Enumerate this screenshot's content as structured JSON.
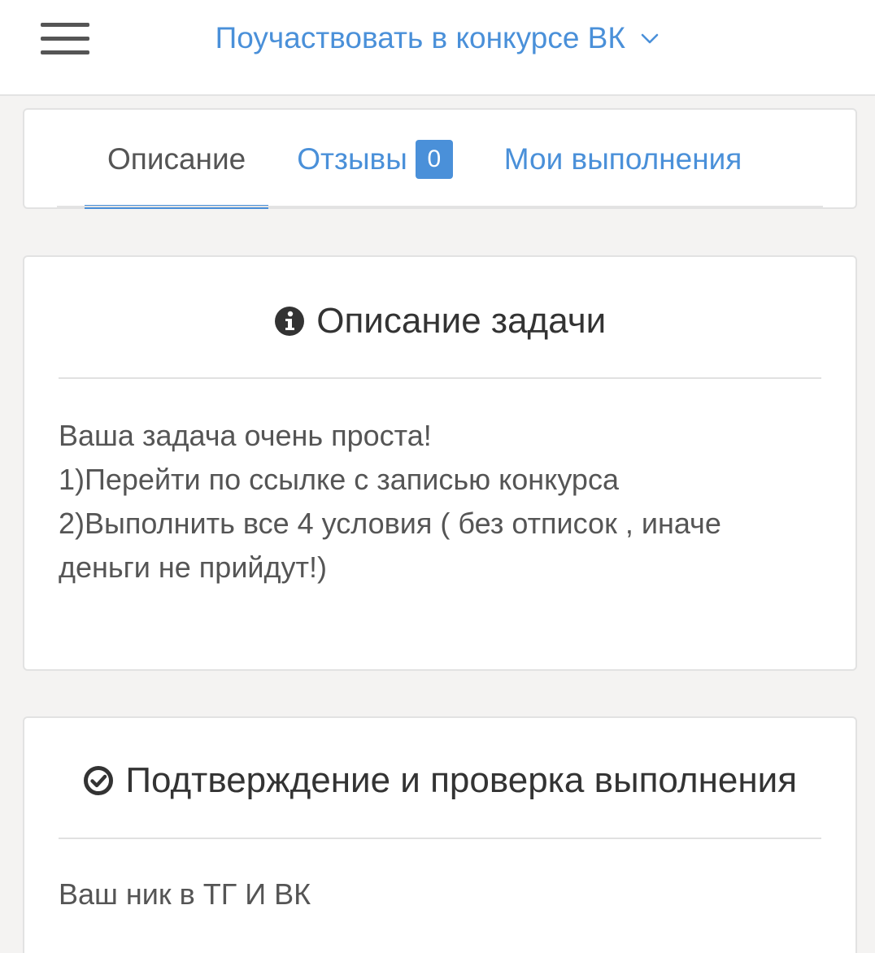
{
  "header": {
    "title": "Поучаствовать в конкурсе ВК",
    "menu_icon": "hamburger-icon",
    "dropdown_icon": "chevron-down-icon",
    "accent_color": "#4a90d9"
  },
  "tabs": [
    {
      "label": "Описание",
      "active": true
    },
    {
      "label": "Отзывы",
      "badge": "0",
      "active": false
    },
    {
      "label": "Мои выполнения",
      "active": false
    }
  ],
  "description_card": {
    "icon": "info-circle-icon",
    "title": "Описание задачи",
    "lines": [
      "Ваша задача очень проста!",
      "1)Перейти по ссылке с записью конкурса",
      "2)Выполнить все 4 условия ( без отписок , иначе",
      "деньги не прийдут!)"
    ]
  },
  "confirmation_card": {
    "icon": "check-circle-icon",
    "title": "Подтверждение и проверка выполнения",
    "text": "Ваш ник в ТГ И ВК"
  }
}
